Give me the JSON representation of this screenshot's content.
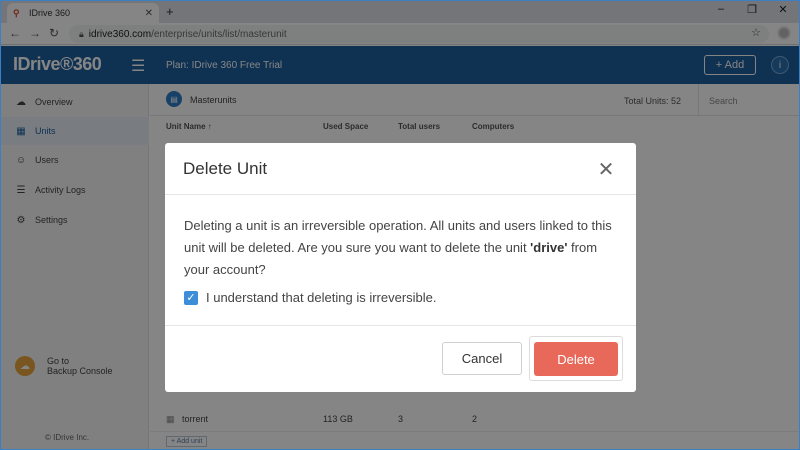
{
  "browser": {
    "tab_title": "IDrive 360",
    "url_host": "idrive360.com",
    "url_path": "/enterprise/units/list/masterunit"
  },
  "header": {
    "logo": "IDrive®360",
    "plan": "Plan: IDrive 360 Free Trial",
    "add_label": "+ Add",
    "info_label": "i"
  },
  "sidebar": {
    "items": [
      {
        "label": "Overview",
        "icon": "cloud-icon"
      },
      {
        "label": "Units",
        "icon": "units-icon"
      },
      {
        "label": "Users",
        "icon": "user-icon"
      },
      {
        "label": "Activity Logs",
        "icon": "log-icon"
      },
      {
        "label": "Settings",
        "icon": "gear-icon"
      }
    ],
    "backup_line1": "Go to",
    "backup_line2": "Backup Console",
    "copyright": "© IDrive Inc."
  },
  "main": {
    "title": "Masterunits",
    "total_units": "Total Units: 52",
    "search_placeholder": "Search",
    "columns": [
      "Unit Name ↑",
      "Used Space",
      "Total users",
      "Computers"
    ],
    "row": {
      "name": "torrent",
      "used_space": "113 GB",
      "total_users": "3",
      "computers": "2"
    },
    "add_unit": "+ Add unit"
  },
  "modal": {
    "title": "Delete Unit",
    "body_before": "Deleting a unit is an irreversible operation. All units and users linked to this unit will be deleted. Are you sure you want to delete the unit ",
    "unit_name": "'drive'",
    "body_after": " from your account?",
    "checkbox_label": "I understand that deleting is irreversible.",
    "cancel_label": "Cancel",
    "delete_label": "Delete"
  },
  "colors": {
    "header_bg": "#1d5f9e",
    "delete_button": "#e8685a",
    "checkbox": "#3d8ed9"
  }
}
